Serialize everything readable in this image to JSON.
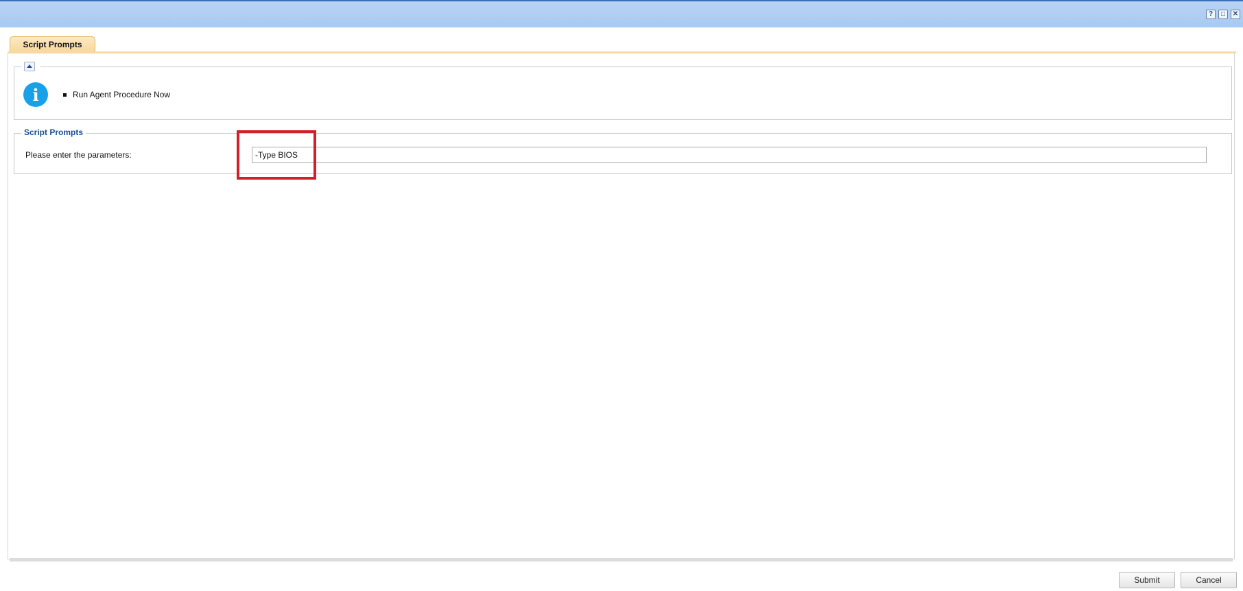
{
  "window": {
    "controls": [
      {
        "name": "help-icon",
        "glyph": "?"
      },
      {
        "name": "maximize-icon",
        "glyph": "□"
      },
      {
        "name": "close-icon",
        "glyph": "✕"
      }
    ]
  },
  "tabs": [
    {
      "label": "Script Prompts",
      "active": true
    }
  ],
  "info": {
    "icon": "info-icon",
    "icon_glyph": "i",
    "items": [
      "Run Agent Procedure Now"
    ]
  },
  "prompts": {
    "legend": "Script Prompts",
    "label": "Please enter the parameters:",
    "value": "-Type BIOS"
  },
  "footer": {
    "submit_label": "Submit",
    "cancel_label": "Cancel"
  },
  "colors": {
    "titlebar": "#a9c9f2",
    "tab": "#f8d89c",
    "accent_text": "#1a4f94",
    "info_icon": "#18a0e8",
    "highlight": "#d0202a"
  }
}
